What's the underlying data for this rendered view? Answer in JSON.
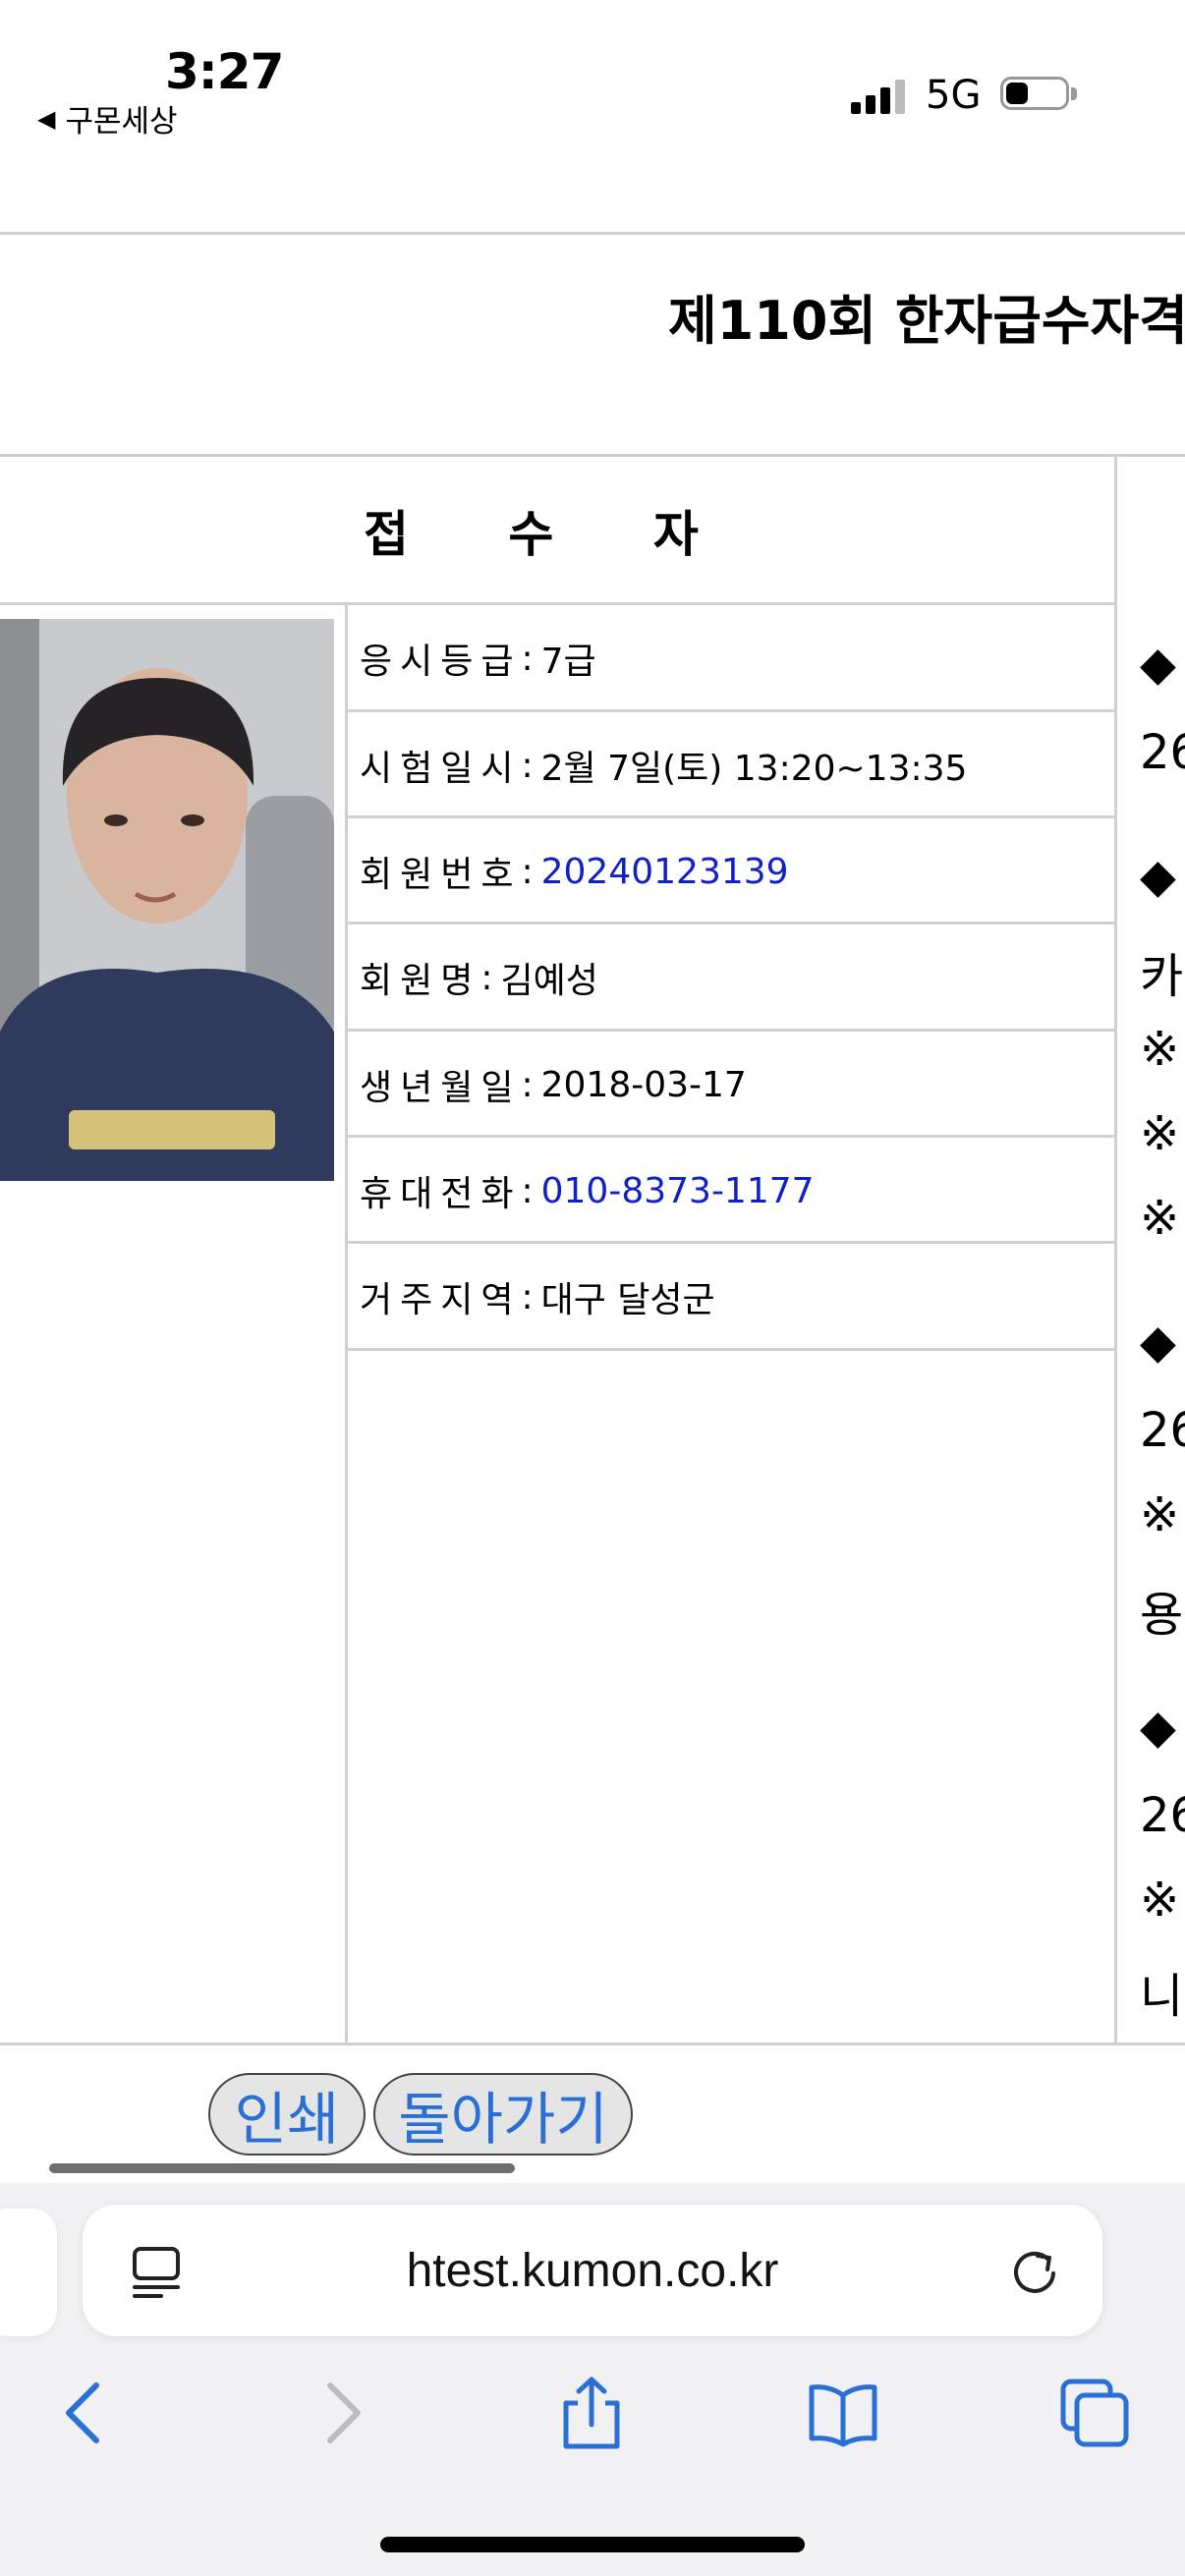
{
  "status_bar": {
    "time": "3:27",
    "back_app": "구몬세상",
    "network": "5G"
  },
  "page": {
    "title": "제110회 한자급수자격",
    "section_header": "접 수 자",
    "fields": [
      {
        "label": "응시등급",
        "value": "7급"
      },
      {
        "label": "시험일시",
        "value": "2월 7일(토) 13:20~13:35"
      },
      {
        "label": "회원번호",
        "value": "20240123139"
      },
      {
        "label": "회원명",
        "value": "김예성"
      },
      {
        "label": "생년월일",
        "value": "2018-03-17"
      },
      {
        "label": "휴대전화",
        "value": "010-8373-1177"
      },
      {
        "label": "거주지역",
        "value": "대구 달성군"
      }
    ],
    "separator": ":",
    "right_column_glyphs": [
      "◆",
      "26",
      "◆",
      "카",
      "※",
      "※",
      "※",
      "◆",
      "26",
      "※",
      "용",
      "◆",
      "26",
      "※",
      "니"
    ]
  },
  "buttons": {
    "print": "인쇄",
    "back": "돌아가기"
  },
  "browser": {
    "url": "htest.kumon.co.kr"
  },
  "icons": {
    "reader": "reader-mode-icon",
    "reload": "reload-icon",
    "back": "back-chevron-icon",
    "forward": "forward-chevron-icon",
    "share": "share-icon",
    "bookmarks": "bookmarks-icon",
    "tabs": "tabs-icon"
  },
  "colors": {
    "link_blue": "#1020c8",
    "button_text": "#2a6fd6",
    "toolbar_bg": "#f1f1f3"
  }
}
